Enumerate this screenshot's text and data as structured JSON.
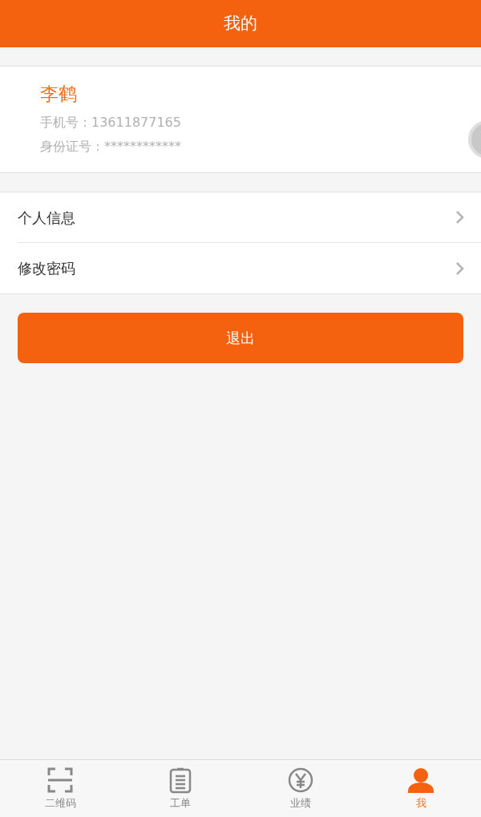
{
  "header": {
    "title": "我的"
  },
  "profile": {
    "name": "李鹤",
    "phone_label": "手机号：",
    "phone": "13611877165",
    "id_label": "身份证号：",
    "id": "************"
  },
  "menu": [
    {
      "label": "个人信息"
    },
    {
      "label": "修改密码"
    }
  ],
  "logout": {
    "label": "退出"
  },
  "tabs": [
    {
      "label": "二维码",
      "kind": "scan",
      "selected": false
    },
    {
      "label": "工单",
      "kind": "clipboard",
      "selected": false
    },
    {
      "label": "业绩",
      "kind": "yen",
      "selected": false
    },
    {
      "label": "我",
      "kind": "person",
      "selected": true
    }
  ]
}
